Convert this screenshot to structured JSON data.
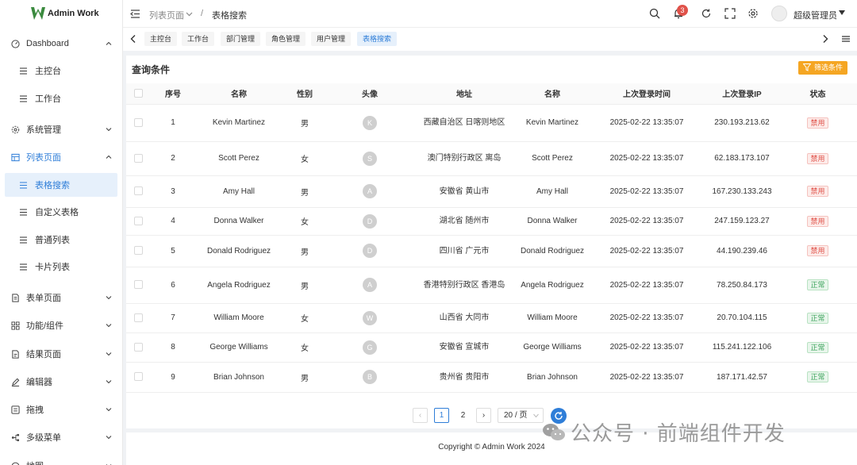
{
  "app": {
    "name": "Admin Work",
    "colors": {
      "accent": "#2f7ed8",
      "brand_green": "#3a8a3e",
      "danger": "#e0524a",
      "success": "#3aa35a",
      "warning": "#f5a623"
    }
  },
  "sidebar": {
    "items": [
      {
        "label": "Dashboard",
        "icon": "dashboard-icon"
      },
      {
        "label": "主控台",
        "icon": "list-icon"
      },
      {
        "label": "工作台",
        "icon": "list-icon"
      },
      {
        "label": "系统管理",
        "icon": "gear-icon"
      },
      {
        "label": "列表页面",
        "icon": "table-icon"
      },
      {
        "label": "表格搜索",
        "icon": "list-icon"
      },
      {
        "label": "自定义表格",
        "icon": "list-icon"
      },
      {
        "label": "普通列表",
        "icon": "list-icon"
      },
      {
        "label": "卡片列表",
        "icon": "list-icon"
      },
      {
        "label": "表单页面",
        "icon": "form-icon"
      },
      {
        "label": "功能/组件",
        "icon": "grid-icon"
      },
      {
        "label": "结果页面",
        "icon": "document-icon"
      },
      {
        "label": "编辑器",
        "icon": "edit-icon"
      },
      {
        "label": "拖拽",
        "icon": "drag-icon"
      },
      {
        "label": "多级菜单",
        "icon": "tree-icon"
      },
      {
        "label": "地图",
        "icon": "map-icon"
      }
    ]
  },
  "header": {
    "breadcrumb": [
      "列表页面",
      "/",
      "表格搜索"
    ],
    "notification_count": "3",
    "username": "超级管理员"
  },
  "tabs": [
    "主控台",
    "工作台",
    "部门管理",
    "角色管理",
    "用户管理",
    "表格搜索"
  ],
  "card": {
    "title": "查询条件",
    "filter_label": "筛选条件"
  },
  "table": {
    "columns": [
      "",
      "序号",
      "名称",
      "性别",
      "头像",
      "地址",
      "名称",
      "上次登录时间",
      "上次登录IP",
      "状态"
    ],
    "rows": [
      {
        "id": "1",
        "name": "Kevin Martinez",
        "gender": "男",
        "avatar": "K",
        "address": "西藏自治区 日喀则地区",
        "name2": "Kevin Martinez",
        "login_time": "2025-02-22 13:35:07",
        "ip": "230.193.213.62",
        "status": "禁用"
      },
      {
        "id": "2",
        "name": "Scott Perez",
        "gender": "女",
        "avatar": "S",
        "address": "澳门特别行政区 离岛",
        "name2": "Scott Perez",
        "login_time": "2025-02-22 13:35:07",
        "ip": "62.183.173.107",
        "status": "禁用"
      },
      {
        "id": "3",
        "name": "Amy Hall",
        "gender": "男",
        "avatar": "A",
        "address": "安徽省 黄山市",
        "name2": "Amy Hall",
        "login_time": "2025-02-22 13:35:07",
        "ip": "167.230.133.243",
        "status": "禁用"
      },
      {
        "id": "4",
        "name": "Donna Walker",
        "gender": "女",
        "avatar": "D",
        "address": "湖北省 随州市",
        "name2": "Donna Walker",
        "login_time": "2025-02-22 13:35:07",
        "ip": "247.159.123.27",
        "status": "禁用"
      },
      {
        "id": "5",
        "name": "Donald Rodriguez",
        "gender": "男",
        "avatar": "D",
        "address": "四川省 广元市",
        "name2": "Donald Rodriguez",
        "login_time": "2025-02-22 13:35:07",
        "ip": "44.190.239.46",
        "status": "禁用"
      },
      {
        "id": "6",
        "name": "Angela Rodriguez",
        "gender": "男",
        "avatar": "A",
        "address": "香港特别行政区 香港岛",
        "name2": "Angela Rodriguez",
        "login_time": "2025-02-22 13:35:07",
        "ip": "78.250.84.173",
        "status": "正常"
      },
      {
        "id": "7",
        "name": "William Moore",
        "gender": "女",
        "avatar": "W",
        "address": "山西省 大同市",
        "name2": "William Moore",
        "login_time": "2025-02-22 13:35:07",
        "ip": "20.70.104.115",
        "status": "正常"
      },
      {
        "id": "8",
        "name": "George Williams",
        "gender": "女",
        "avatar": "G",
        "address": "安徽省 宣城市",
        "name2": "George Williams",
        "login_time": "2025-02-22 13:35:07",
        "ip": "115.241.122.106",
        "status": "正常"
      },
      {
        "id": "9",
        "name": "Brian Johnson",
        "gender": "男",
        "avatar": "B",
        "address": "贵州省 贵阳市",
        "name2": "Brian Johnson",
        "login_time": "2025-02-22 13:35:07",
        "ip": "187.171.42.57",
        "status": "正常"
      }
    ]
  },
  "pagination": {
    "pages": [
      "1",
      "2"
    ],
    "current": "1",
    "page_size": "20 / 页"
  },
  "footer": {
    "copyright": "Copyright © Admin Work 2024"
  },
  "watermark": {
    "text": "公众号 · 前端组件开发"
  }
}
